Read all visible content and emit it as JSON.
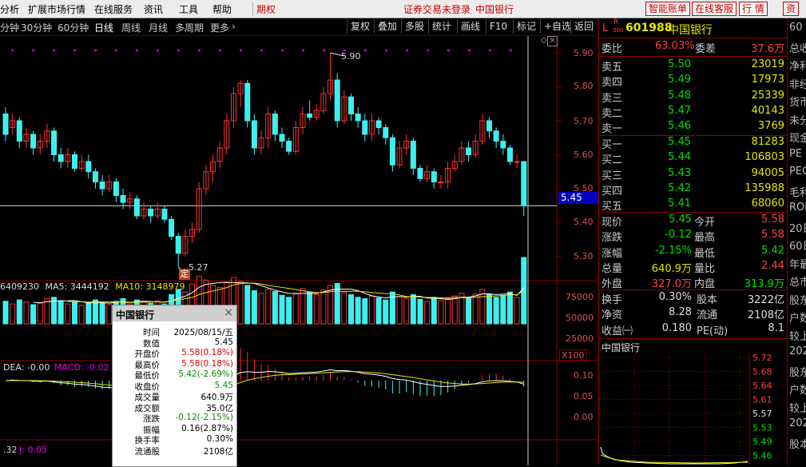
{
  "menu": {
    "items": [
      "分析",
      "扩展市场行情",
      "在线服务",
      "资讯",
      "工具",
      "帮助"
    ],
    "period_btn": "期权",
    "status": "证券交易未登录",
    "stock_name_top": "中国银行",
    "right_buttons": [
      "智能账单",
      "在线客服",
      "行  情",
      "资"
    ]
  },
  "toolbar": {
    "periods": [
      "分钟",
      "30分钟",
      "60分钟",
      "日线",
      "周线",
      "月线",
      "多周期",
      "更多"
    ],
    "selected": "日线",
    "more_arrow": "›",
    "tools": [
      "复权",
      "叠加",
      "多股",
      "统计",
      "画线",
      "F10",
      "标记",
      "+自选",
      "返回"
    ]
  },
  "main_chart": {
    "price_axis": [
      "5.90",
      "5.80",
      "5.70",
      "5.60",
      "5.50",
      "5.40",
      "5.30"
    ],
    "current_price_tag": "5.45",
    "high_marker": "5.90",
    "low_marker": "5.27",
    "ding_marker": "定"
  },
  "vol_chart": {
    "header_vol": "6409230",
    "ma5_label": "MA5:",
    "ma5_value": "3444192",
    "ma10_label": "MA10:",
    "ma10_value": "3148979",
    "axis": [
      "75000",
      "50000",
      "25000"
    ],
    "unit": "X100"
  },
  "macd_chart": {
    "dea_label": "DEA: -0.00",
    "macd_label": "MACD: -0.02",
    "axis": [
      "0.10",
      "0.05",
      "0.00"
    ]
  },
  "kdj_chart": {
    "k_label": ".32",
    "j_label": "J: 0.05"
  },
  "quote": {
    "code_prefix": "L",
    "r_badge": "R",
    "r_sub": "300",
    "code": "601988",
    "name": "中国银行",
    "webi_label": "委比",
    "webi_value": "63.03%",
    "weicha_label": "委差",
    "weicha_value": "37.6万",
    "asks": [
      {
        "label": "卖五",
        "price": "5.50",
        "vol": "23019"
      },
      {
        "label": "卖四",
        "price": "5.49",
        "vol": "17973"
      },
      {
        "label": "卖三",
        "price": "5.48",
        "vol": "25339"
      },
      {
        "label": "卖二",
        "price": "5.47",
        "vol": "40143"
      },
      {
        "label": "卖一",
        "price": "5.46",
        "vol": "3769"
      }
    ],
    "bids": [
      {
        "label": "买一",
        "price": "5.45",
        "vol": "81283"
      },
      {
        "label": "买二",
        "price": "5.44",
        "vol": "106803"
      },
      {
        "label": "买三",
        "price": "5.43",
        "vol": "94005"
      },
      {
        "label": "买四",
        "price": "5.42",
        "vol": "135988"
      },
      {
        "label": "买五",
        "price": "5.41",
        "vol": "68060"
      }
    ],
    "stats": [
      {
        "l1": "现价",
        "v1": "5.45",
        "c1": "grn",
        "l2": "今开",
        "v2": "5.58",
        "c2": "red"
      },
      {
        "l1": "涨跌",
        "v1": "-0.12",
        "c1": "grn",
        "l2": "最高",
        "v2": "5.58",
        "c2": "red"
      },
      {
        "l1": "涨幅",
        "v1": "-2.15%",
        "c1": "grn",
        "l2": "最低",
        "v2": "5.42",
        "c2": "grn"
      },
      {
        "l1": "总量",
        "v1": "640.9万",
        "c1": "yel",
        "l2": "量比",
        "v2": "2.44",
        "c2": "red"
      },
      {
        "l1": "外盘",
        "v1": "327.0万",
        "c1": "red",
        "l2": "内盘",
        "v2": "313.9万",
        "c2": "grn"
      }
    ],
    "fin": [
      {
        "l1": "换手",
        "v1": "0.30%",
        "l2": "股本",
        "v2": "3222亿"
      },
      {
        "l1": "净资",
        "v1": "8.28",
        "l2": "流通",
        "v2": "2108亿"
      },
      {
        "l1": "收益㈠",
        "v1": "0.180",
        "l2": "PE(动)",
        "v2": "8.1"
      }
    ],
    "mini_title": "中国银行",
    "mini_axis": [
      "5.72",
      "5.68",
      "5.64",
      "5.61",
      "5.57",
      "5.53",
      "5.49",
      "5.46"
    ]
  },
  "far_right": [
    "60",
    "总收",
    "净利",
    "非经",
    "货币",
    "未分",
    "现金",
    "PE",
    "PEG",
    "毛利",
    "ROE",
    "20日",
    "60日",
    "年最",
    "总市",
    "股东",
    "户数",
    "较上",
    "202",
    "股东",
    "户数",
    "较上",
    "202",
    "股本"
  ],
  "tooltip": {
    "title": "中国银行",
    "close_icon": "×",
    "rows": [
      {
        "k": "时间",
        "v": "2025/08/15/五",
        "c": "#000"
      },
      {
        "k": "数值",
        "v": "5.45",
        "c": "#000"
      },
      {
        "k": "开盘价",
        "v": "5.58(0.18%)",
        "c": "#d00"
      },
      {
        "k": "最高价",
        "v": "5.58(0.18%)",
        "c": "#d00"
      },
      {
        "k": "最低价",
        "v": "5.42(-2.69%)",
        "c": "#080"
      },
      {
        "k": "收盘价",
        "v": "5.45",
        "c": "#080"
      },
      {
        "k": "成交量",
        "v": "640.9万",
        "c": "#000"
      },
      {
        "k": "成交额",
        "v": "35.0亿",
        "c": "#000"
      },
      {
        "k": "涨跌",
        "v": "-0.12(-2.15%)",
        "c": "#080"
      },
      {
        "k": "振幅",
        "v": "0.16(2.87%)",
        "c": "#000"
      },
      {
        "k": "换手率",
        "v": "0.30%",
        "c": "#000"
      },
      {
        "k": "流通股",
        "v": "2108亿",
        "c": "#000"
      }
    ]
  },
  "candles": [
    [
      5.72,
      5.66,
      5.74,
      5.64
    ],
    [
      5.68,
      5.7,
      5.72,
      5.66
    ],
    [
      5.7,
      5.64,
      5.71,
      5.62
    ],
    [
      5.64,
      5.66,
      5.68,
      5.62
    ],
    [
      5.66,
      5.62,
      5.67,
      5.6
    ],
    [
      5.62,
      5.64,
      5.66,
      5.6
    ],
    [
      5.64,
      5.67,
      5.69,
      5.62
    ],
    [
      5.67,
      5.6,
      5.68,
      5.58
    ],
    [
      5.6,
      5.58,
      5.62,
      5.56
    ],
    [
      5.58,
      5.6,
      5.62,
      5.56
    ],
    [
      5.6,
      5.56,
      5.61,
      5.55
    ],
    [
      5.56,
      5.58,
      5.6,
      5.55
    ],
    [
      5.58,
      5.55,
      5.6,
      5.53
    ],
    [
      5.55,
      5.52,
      5.56,
      5.5
    ],
    [
      5.52,
      5.5,
      5.54,
      5.48
    ],
    [
      5.5,
      5.52,
      5.54,
      5.49
    ],
    [
      5.52,
      5.48,
      5.53,
      5.46
    ],
    [
      5.48,
      5.46,
      5.5,
      5.44
    ],
    [
      5.46,
      5.47,
      5.49,
      5.44
    ],
    [
      5.47,
      5.42,
      5.48,
      5.41
    ],
    [
      5.42,
      5.44,
      5.46,
      5.41
    ],
    [
      5.44,
      5.42,
      5.45,
      5.4
    ],
    [
      5.42,
      5.44,
      5.46,
      5.41
    ],
    [
      5.44,
      5.41,
      5.45,
      5.4
    ],
    [
      5.41,
      5.36,
      5.42,
      5.35
    ],
    [
      5.36,
      5.31,
      5.37,
      5.27
    ],
    [
      5.31,
      5.36,
      5.38,
      5.3
    ],
    [
      5.36,
      5.38,
      5.4,
      5.34
    ],
    [
      5.38,
      5.5,
      5.52,
      5.37
    ],
    [
      5.5,
      5.55,
      5.57,
      5.48
    ],
    [
      5.55,
      5.58,
      5.6,
      5.52
    ],
    [
      5.58,
      5.62,
      5.64,
      5.56
    ],
    [
      5.62,
      5.7,
      5.72,
      5.6
    ],
    [
      5.7,
      5.78,
      5.8,
      5.68
    ],
    [
      5.78,
      5.81,
      5.82,
      5.74
    ],
    [
      5.81,
      5.7,
      5.82,
      5.68
    ],
    [
      5.7,
      5.62,
      5.72,
      5.6
    ],
    [
      5.62,
      5.65,
      5.67,
      5.6
    ],
    [
      5.65,
      5.72,
      5.74,
      5.62
    ],
    [
      5.72,
      5.66,
      5.73,
      5.64
    ],
    [
      5.66,
      5.64,
      5.68,
      5.62
    ],
    [
      5.64,
      5.61,
      5.65,
      5.6
    ],
    [
      5.61,
      5.68,
      5.7,
      5.6
    ],
    [
      5.68,
      5.72,
      5.74,
      5.66
    ],
    [
      5.72,
      5.71,
      5.76,
      5.7
    ],
    [
      5.71,
      5.73,
      5.75,
      5.7
    ],
    [
      5.73,
      5.78,
      5.8,
      5.72
    ],
    [
      5.78,
      5.82,
      5.9,
      5.76
    ],
    [
      5.82,
      5.7,
      5.84,
      5.68
    ],
    [
      5.7,
      5.77,
      5.79,
      5.69
    ],
    [
      5.77,
      5.72,
      5.78,
      5.7
    ],
    [
      5.72,
      5.7,
      5.74,
      5.68
    ],
    [
      5.7,
      5.66,
      5.72,
      5.64
    ],
    [
      5.66,
      5.7,
      5.72,
      5.64
    ],
    [
      5.7,
      5.68,
      5.71,
      5.66
    ],
    [
      5.68,
      5.65,
      5.69,
      5.63
    ],
    [
      5.65,
      5.57,
      5.66,
      5.55
    ],
    [
      5.57,
      5.62,
      5.64,
      5.56
    ],
    [
      5.62,
      5.64,
      5.66,
      5.6
    ],
    [
      5.64,
      5.56,
      5.65,
      5.54
    ],
    [
      5.56,
      5.53,
      5.57,
      5.52
    ],
    [
      5.53,
      5.55,
      5.57,
      5.52
    ],
    [
      5.55,
      5.52,
      5.56,
      5.5
    ],
    [
      5.52,
      5.52,
      5.54,
      5.5
    ],
    [
      5.52,
      5.56,
      5.58,
      5.5
    ],
    [
      5.56,
      5.58,
      5.6,
      5.55
    ],
    [
      5.58,
      5.62,
      5.64,
      5.57
    ],
    [
      5.62,
      5.6,
      5.64,
      5.58
    ],
    [
      5.6,
      5.64,
      5.66,
      5.59
    ],
    [
      5.64,
      5.7,
      5.72,
      5.63
    ],
    [
      5.7,
      5.67,
      5.71,
      5.65
    ],
    [
      5.67,
      5.64,
      5.68,
      5.62
    ],
    [
      5.64,
      5.62,
      5.66,
      5.6
    ],
    [
      5.62,
      5.58,
      5.63,
      5.57
    ],
    [
      5.58,
      5.58,
      5.6,
      5.56
    ],
    [
      5.58,
      5.45,
      5.58,
      5.42
    ]
  ],
  "volumes": [
    34,
    30,
    36,
    33,
    29,
    31,
    38,
    40,
    35,
    30,
    33,
    28,
    32,
    36,
    31,
    29,
    34,
    38,
    30,
    36,
    33,
    31,
    35,
    30,
    44,
    52,
    48,
    60,
    72,
    66,
    58,
    55,
    62,
    70,
    64,
    58,
    50,
    46,
    52,
    49,
    43,
    40,
    45,
    53,
    48,
    44,
    51,
    58,
    61,
    47,
    44,
    40,
    38,
    42,
    39,
    36,
    48,
    41,
    38,
    44,
    37,
    34,
    40,
    35,
    38,
    42,
    46,
    40,
    45,
    52,
    44,
    40,
    43,
    48,
    40,
    100
  ],
  "colors": {
    "up": "#ff3030",
    "down": "#3df0f0",
    "ma5": "#ffffff",
    "ma10": "#e6e600",
    "ma_purple": "#e000e0"
  }
}
